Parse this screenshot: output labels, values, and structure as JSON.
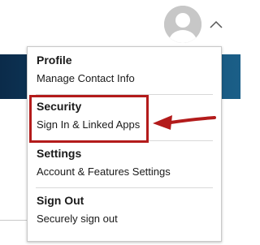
{
  "header": {
    "avatar_icon": "user-avatar-icon",
    "menu_toggle_icon": "chevron-up-icon"
  },
  "menu": {
    "items": [
      {
        "title": "Profile",
        "subtitle": "Manage Contact Info"
      },
      {
        "title": "Security",
        "subtitle": "Sign In & Linked Apps"
      },
      {
        "title": "Settings",
        "subtitle": "Account & Features Settings"
      },
      {
        "title": "Sign Out",
        "subtitle": "Securely sign out"
      }
    ]
  },
  "annotation": {
    "highlight_color": "#b31b1b",
    "arrow_icon": "pointer-arrow-icon"
  },
  "colors": {
    "banner": "#12496f",
    "menu_border": "#c9c9c9",
    "text": "#1a1a1a",
    "avatar": "#c7c7c7"
  }
}
